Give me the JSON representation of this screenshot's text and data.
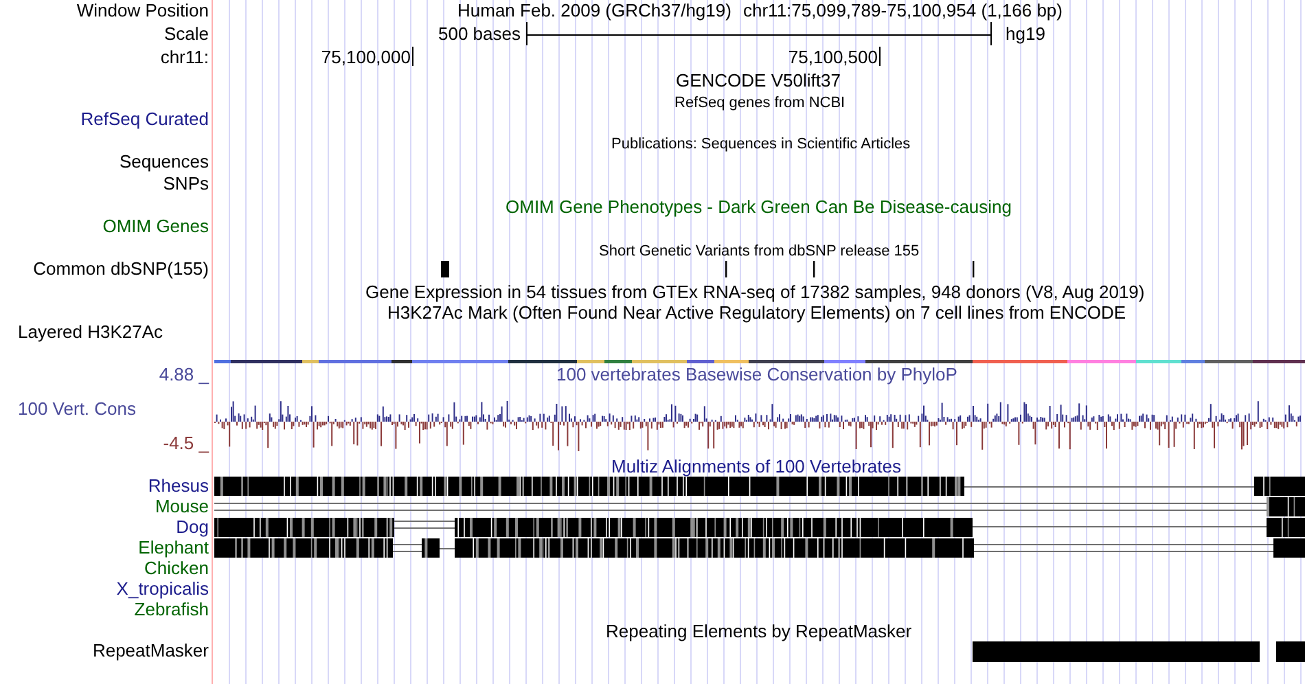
{
  "side_labels": [
    {
      "text": "Window Position",
      "color": "#000000"
    },
    {
      "text": "Scale",
      "color": "#000000"
    },
    {
      "text": "chr11:",
      "color": "#000000"
    },
    {
      "text": "RefSeq Curated",
      "color": "#1c1c8c"
    },
    {
      "text": "Sequences",
      "color": "#000000"
    },
    {
      "text": "SNPs",
      "color": "#000000"
    },
    {
      "text": "OMIM Genes",
      "color": "#006400"
    },
    {
      "text": "Common dbSNP(155)",
      "color": "#000000"
    },
    {
      "text": "Layered H3K27Ac",
      "color": "#000000"
    },
    {
      "text": "4.88 _",
      "color": "#4a4a9a"
    },
    {
      "text": "100 Vert. Cons",
      "color": "#4a4a9a"
    },
    {
      "text": "-4.5 _",
      "color": "#8b3a3a"
    },
    {
      "text": "Rhesus",
      "color": "#1c1c8c"
    },
    {
      "text": "Mouse",
      "color": "#006400"
    },
    {
      "text": "Dog",
      "color": "#1c1c8c"
    },
    {
      "text": "Elephant",
      "color": "#006400"
    },
    {
      "text": "Chicken",
      "color": "#006400"
    },
    {
      "text": "X_tropicalis",
      "color": "#1c1c8c"
    },
    {
      "text": "Zebrafish",
      "color": "#006400"
    },
    {
      "text": "RepeatMasker",
      "color": "#000000"
    }
  ],
  "position": {
    "assembly": "Human Feb. 2009 (GRCh37/hg19)",
    "range": "chr11:75,099,789-75,100,954 (1,166 bp)"
  },
  "scale": {
    "label": "500 bases",
    "db": "hg19"
  },
  "ruler": {
    "ticks": [
      "75,100,000",
      "75,100,500"
    ]
  },
  "track_titles": [
    {
      "text": "GENCODE V50lift37",
      "color": "#000000"
    },
    {
      "text": "RefSeq genes from NCBI",
      "color": "#000000"
    },
    {
      "text": "Publications: Sequences in Scientific Articles",
      "color": "#000000"
    },
    {
      "text": "OMIM Gene Phenotypes - Dark Green Can Be Disease-causing",
      "color": "#006400"
    },
    {
      "text": "Short Genetic Variants from dbSNP release 155",
      "color": "#000000"
    },
    {
      "text": "Gene Expression in 54 tissues from GTEx RNA-seq of 17382 samples, 948 donors (V8, Aug 2019)",
      "color": "#000000"
    },
    {
      "text": "H3K27Ac Mark (Often Found Near Active Regulatory Elements) on 7 cell lines from ENCODE",
      "color": "#000000"
    },
    {
      "text": "100 vertebrates Basewise Conservation by PhyloP",
      "color": "#4a4a9a"
    },
    {
      "text": "Multiz Alignments of 100 Vertebrates",
      "color": "#1c1c8c"
    },
    {
      "text": "Repeating Elements by RepeatMasker",
      "color": "#000000"
    }
  ]
}
